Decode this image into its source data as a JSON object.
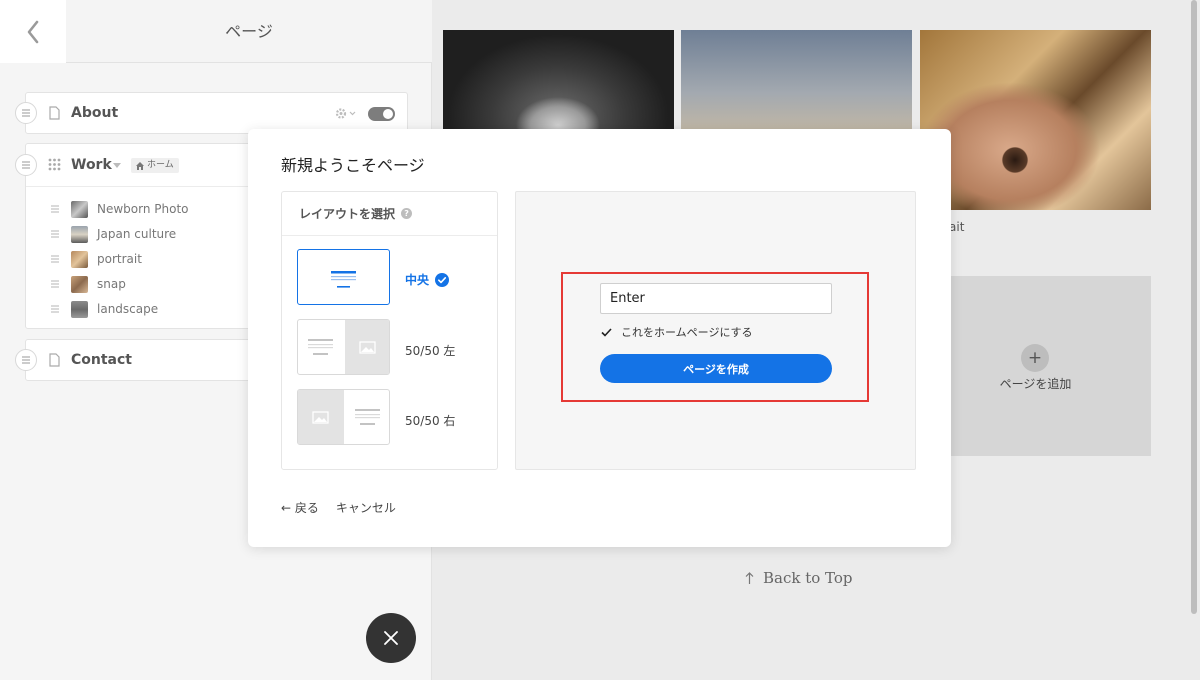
{
  "left_panel": {
    "title": "ページ",
    "pages": {
      "about": {
        "title": "About"
      },
      "work": {
        "title": "Work",
        "home_badge": "ホーム",
        "items": [
          "Newborn Photo",
          "Japan culture",
          "portrait",
          "snap",
          "landscape"
        ]
      },
      "contact": {
        "title": "Contact"
      }
    }
  },
  "right_panel": {
    "photo_caption": "ait",
    "add_page_label": "ページを追加",
    "back_to_top": "Back to Top"
  },
  "modal": {
    "title": "新規ようこそページ",
    "layout_header": "レイアウトを選択",
    "options": [
      {
        "label": "中央",
        "selected": true
      },
      {
        "label": "50/50 左",
        "selected": false
      },
      {
        "label": "50/50 右",
        "selected": false
      }
    ],
    "name_input_value": "Enter",
    "home_checkbox_label": "これをホームページにする",
    "home_checkbox_checked": true,
    "create_button": "ページを作成",
    "back_link": "← 戻る",
    "cancel_link": "キャンセル"
  },
  "colors": {
    "accent": "#1473e6",
    "highlight_border": "#e53935",
    "fab": "#333333"
  }
}
